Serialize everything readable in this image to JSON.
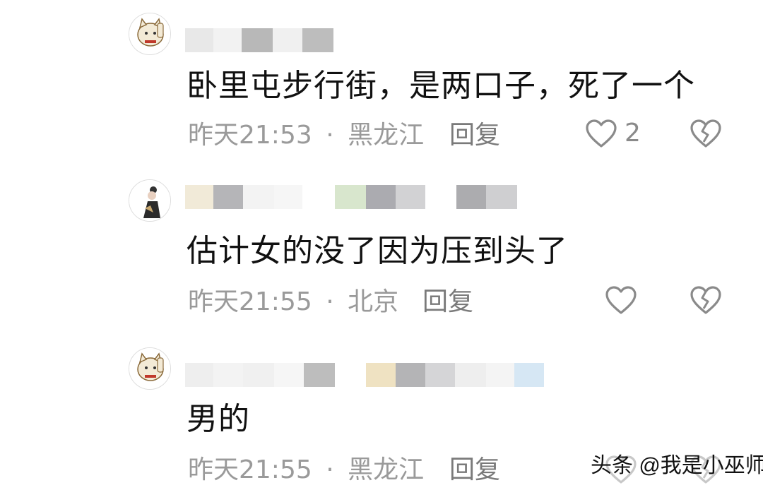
{
  "comments": [
    {
      "text": "卧里屯步行街，是两口子，死了一个",
      "time": "昨天21:53",
      "separator": "·",
      "location": "黑龙江",
      "reply": "回复",
      "likes": "2"
    },
    {
      "text": "估计女的没了因为压到头了",
      "time": "昨天21:55",
      "separator": "·",
      "location": "北京",
      "reply": "回复",
      "likes": ""
    },
    {
      "text": "男的",
      "time": "昨天21:55",
      "separator": "·",
      "location": "黑龙江",
      "reply": "回复",
      "likes": ""
    }
  ],
  "avatars": {
    "cat_text": "招财猫"
  },
  "watermark": "头条 @我是小巫师",
  "colors": {
    "meta_gray": "#9a9a9a",
    "reply_gray": "#7a7a7a",
    "icon_gray": "#8a8a8a"
  },
  "icons": [
    "heart-outline-icon",
    "broken-heart-icon",
    "lucky-cat-avatar",
    "woman-avatar"
  ]
}
